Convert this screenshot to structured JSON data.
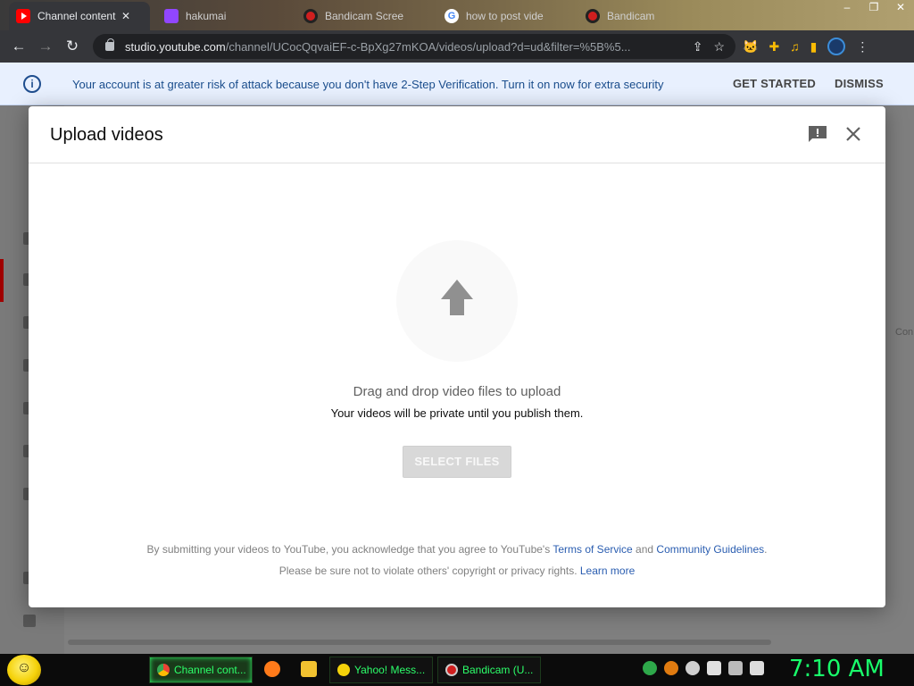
{
  "browser": {
    "tabs": [
      {
        "label": "Channel content",
        "icon": "youtube-icon",
        "active": true
      },
      {
        "label": "hakumai",
        "icon": "twitch-icon"
      },
      {
        "label": "Bandicam Scree",
        "icon": "bandicam-icon"
      },
      {
        "label": "how to post vide",
        "icon": "google-icon"
      },
      {
        "label": "Bandicam",
        "icon": "bandicam-icon"
      }
    ],
    "url_host": "studio.youtube.com",
    "url_path": "/channel/UCocQqvaiEF-c-BpXg27mKOA/videos/upload?d=ud&filter=%5B%5..."
  },
  "banner": {
    "message": "Your account is at greater risk of attack because you don't have 2-Step Verification. Turn it on now for extra security",
    "get_started": "GET STARTED",
    "dismiss": "DISMISS"
  },
  "studio": {
    "right_text": "Con"
  },
  "dialog": {
    "title": "Upload videos",
    "drag_text": "Drag and drop video files to upload",
    "private_text": "Your videos will be private until you publish them.",
    "select_button": "SELECT FILES",
    "legal_prefix": "By submitting your videos to YouTube, you acknowledge that you agree to YouTube's ",
    "terms_link": "Terms of Service",
    "and_text": " and ",
    "guidelines_link": "Community Guidelines",
    "period": ".",
    "rights_text": "Please be sure not to violate others' copyright or privacy rights. ",
    "learn_more": "Learn more"
  },
  "taskbar": {
    "tasks": [
      {
        "label": "Channel cont..."
      },
      {
        "label": "Yahoo! Mess..."
      },
      {
        "label": "Bandicam (U..."
      }
    ],
    "clock": "7:10 AM"
  },
  "colors": {
    "accent_link": "#2a5db0",
    "banner_bg": "#e8f0fe",
    "taskbar_text": "#2cff6a"
  }
}
